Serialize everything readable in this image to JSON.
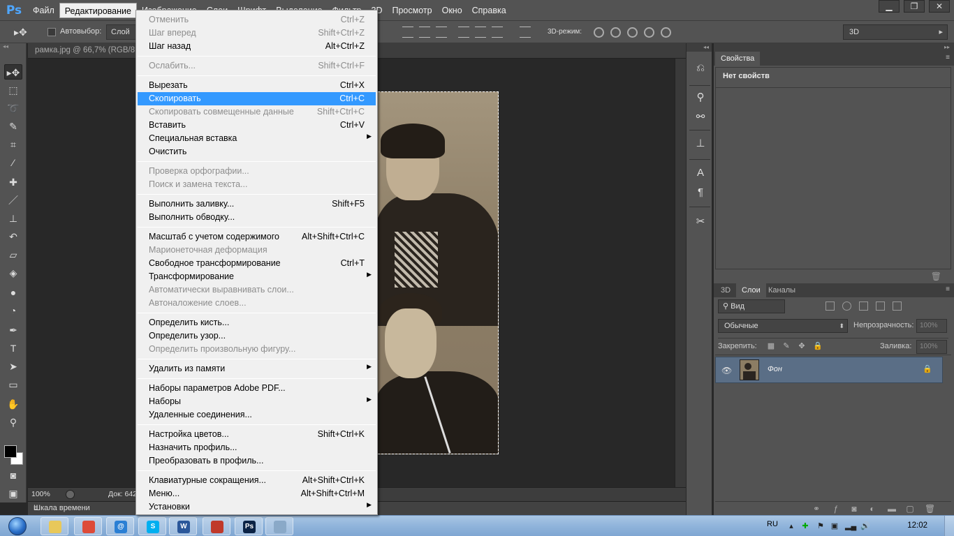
{
  "app": {
    "logo": "Ps"
  },
  "menubar": {
    "items": [
      {
        "label": "Файл"
      },
      {
        "label": "Редактирование"
      },
      {
        "label": "Изображение"
      },
      {
        "label": "Слои"
      },
      {
        "label": "Шрифт"
      },
      {
        "label": "Выделение"
      },
      {
        "label": "Фильтр"
      },
      {
        "label": "3D"
      },
      {
        "label": "Просмотр"
      },
      {
        "label": "Окно"
      },
      {
        "label": "Справка"
      }
    ],
    "active_index": 1
  },
  "window_controls": {
    "minimize": "▁",
    "restore": "❐",
    "close": "✕"
  },
  "options_bar": {
    "autoselect_label": "Автовыбор:",
    "autoselect_checked": false,
    "layer_select": "Слой",
    "mode_3d_label": "3D-режим:",
    "workspace": "3D"
  },
  "document": {
    "tab_title": "рамка.jpg @ 66,7% (RGB/8",
    "zoom": "100%",
    "doc_info": "Док: 642"
  },
  "timeline": {
    "label": "Шкала времени"
  },
  "edit_menu": {
    "items": [
      {
        "label": "Отменить",
        "shortcut": "Ctrl+Z",
        "disabled": true
      },
      {
        "label": "Шаг вперед",
        "shortcut": "Shift+Ctrl+Z",
        "disabled": true
      },
      {
        "label": "Шаг назад",
        "shortcut": "Alt+Ctrl+Z",
        "disabled": false
      },
      {
        "sep": true
      },
      {
        "label": "Ослабить...",
        "shortcut": "Shift+Ctrl+F",
        "disabled": true
      },
      {
        "sep": true
      },
      {
        "label": "Вырезать",
        "shortcut": "Ctrl+X",
        "disabled": false
      },
      {
        "label": "Скопировать",
        "shortcut": "Ctrl+C",
        "disabled": false,
        "highlighted": true
      },
      {
        "label": "Скопировать совмещенные данные",
        "shortcut": "Shift+Ctrl+C",
        "disabled": true
      },
      {
        "label": "Вставить",
        "shortcut": "Ctrl+V",
        "disabled": false
      },
      {
        "label": "Специальная вставка",
        "shortcut": "",
        "submenu": true
      },
      {
        "label": "Очистить",
        "shortcut": "",
        "disabled": false
      },
      {
        "sep": true
      },
      {
        "label": "Проверка орфографии...",
        "shortcut": "",
        "disabled": true
      },
      {
        "label": "Поиск и замена текста...",
        "shortcut": "",
        "disabled": true
      },
      {
        "sep": true
      },
      {
        "label": "Выполнить заливку...",
        "shortcut": "Shift+F5",
        "disabled": false
      },
      {
        "label": "Выполнить обводку...",
        "shortcut": "",
        "disabled": false
      },
      {
        "sep": true
      },
      {
        "label": "Масштаб с учетом содержимого",
        "shortcut": "Alt+Shift+Ctrl+C",
        "disabled": false
      },
      {
        "label": "Марионеточная деформация",
        "shortcut": "",
        "disabled": true
      },
      {
        "label": "Свободное трансформирование",
        "shortcut": "Ctrl+T",
        "disabled": false
      },
      {
        "label": "Трансформирование",
        "shortcut": "",
        "submenu": true
      },
      {
        "label": "Автоматически выравнивать слои...",
        "shortcut": "",
        "disabled": true
      },
      {
        "label": "Автоналожение слоев...",
        "shortcut": "",
        "disabled": true
      },
      {
        "sep": true
      },
      {
        "label": "Определить кисть...",
        "shortcut": "",
        "disabled": false
      },
      {
        "label": "Определить узор...",
        "shortcut": "",
        "disabled": false
      },
      {
        "label": "Определить произвольную фигуру...",
        "shortcut": "",
        "disabled": true
      },
      {
        "sep": true
      },
      {
        "label": "Удалить из памяти",
        "shortcut": "",
        "submenu": true
      },
      {
        "sep": true
      },
      {
        "label": "Наборы параметров Adobe PDF...",
        "shortcut": "",
        "disabled": false
      },
      {
        "label": "Наборы",
        "shortcut": "",
        "submenu": true
      },
      {
        "label": "Удаленные соединения...",
        "shortcut": "",
        "disabled": false
      },
      {
        "sep": true
      },
      {
        "label": "Настройка цветов...",
        "shortcut": "Shift+Ctrl+K",
        "disabled": false
      },
      {
        "label": "Назначить профиль...",
        "shortcut": "",
        "disabled": false
      },
      {
        "label": "Преобразовать в профиль...",
        "shortcut": "",
        "disabled": false
      },
      {
        "sep": true
      },
      {
        "label": "Клавиатурные сокращения...",
        "shortcut": "Alt+Shift+Ctrl+K",
        "disabled": false
      },
      {
        "label": "Меню...",
        "shortcut": "Alt+Shift+Ctrl+M",
        "disabled": false
      },
      {
        "label": "Установки",
        "shortcut": "",
        "submenu": true
      }
    ]
  },
  "properties_panel": {
    "tab": "Свойства",
    "empty_text": "Нет свойств"
  },
  "layers_panel": {
    "tabs": [
      "3D",
      "Слои",
      "Каналы"
    ],
    "active_tab": 1,
    "filter_label": "Вид",
    "blend_mode": "Обычные",
    "opacity_label": "Непрозрачность:",
    "opacity_value": "100%",
    "lock_label": "Закрепить:",
    "fill_label": "Заливка:",
    "fill_value": "100%",
    "layers": [
      {
        "name": "Фон",
        "visible": true,
        "locked": true
      }
    ]
  },
  "taskbar": {
    "apps": [
      {
        "name": "explorer",
        "glyph": "",
        "color": "#e8c85a"
      },
      {
        "name": "chrome",
        "glyph": "",
        "color": "#dd4b39"
      },
      {
        "name": "mail-agent",
        "glyph": "@",
        "color": "#2b7fd4"
      },
      {
        "name": "skype",
        "glyph": "S",
        "color": "#00aff0"
      },
      {
        "name": "word",
        "glyph": "W",
        "color": "#2b579a"
      },
      {
        "name": "paint",
        "glyph": "",
        "color": "#c0392b"
      },
      {
        "name": "photoshop",
        "glyph": "Ps",
        "color": "#0b2345"
      },
      {
        "name": "app",
        "glyph": "",
        "color": "#8aa9c8"
      }
    ],
    "language": "RU",
    "time": "12:02"
  },
  "colors": {
    "highlight": "#3399ff",
    "ps_blue": "#4fa7ff",
    "layer_selected": "#5a6e86"
  }
}
